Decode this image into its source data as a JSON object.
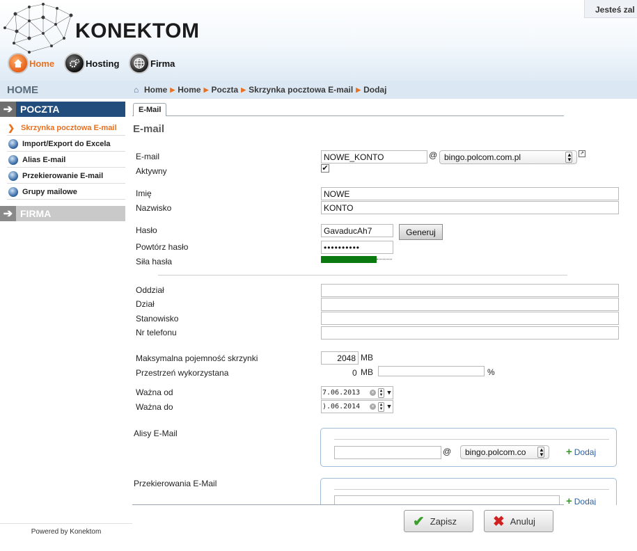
{
  "header": {
    "logo_text": "KONEKTOM",
    "user_status": "Jesteś zal"
  },
  "topnav": [
    {
      "label": "Home"
    },
    {
      "label": "Hosting"
    },
    {
      "label": "Firma"
    }
  ],
  "sidebar": {
    "home_label": "HOME",
    "section_poczta": "POCZTA",
    "items": [
      {
        "label": "Skrzynka pocztowa E-mail"
      },
      {
        "label": "Import/Export do Excela"
      },
      {
        "label": "Alias E-mail"
      },
      {
        "label": "Przekierowanie E-mail"
      },
      {
        "label": "Grupy mailowe"
      }
    ],
    "section_firma": "FIRMA",
    "powered": "Powered by Konektom"
  },
  "breadcrumb": [
    "Home",
    "Home",
    "Poczta",
    "Skrzynka pocztowa E-mail",
    "Dodaj"
  ],
  "tab": {
    "label": "E-Mail"
  },
  "form": {
    "title": "E-mail",
    "email_label": "E-mail",
    "email_value": "NOWE_KONTO",
    "at_sign": "@",
    "domain_value": "bingo.polcom.com.pl",
    "active_label": "Aktywny",
    "active_checked": true,
    "first_name_label": "Imię",
    "first_name_value": "NOWE",
    "last_name_label": "Nazwisko",
    "last_name_value": "KONTO",
    "password_label": "Hasło",
    "password_value": "GavaducAh7",
    "generate_button": "Generuj",
    "repeat_password_label": "Powtórz hasło",
    "repeat_password_value": "••••••••••",
    "strength_label": "Siła hasła",
    "strength_fraction": 0.78,
    "branch_label": "Oddział",
    "department_label": "Dział",
    "position_label": "Stanowisko",
    "phone_label": "Nr telefonu",
    "max_capacity_label": "Maksymalna pojemność skrzynki",
    "max_capacity_value": "2048",
    "mb_unit": "MB",
    "used_space_label": "Przestrzeń wykorzystana",
    "used_space_value": "0",
    "percent_sign": "%",
    "valid_from_label": "Ważna od",
    "valid_from_value": "7.06.2013",
    "valid_to_label": "Ważna do",
    "valid_to_value": ").06.2014",
    "aliases_label": "Alisy E-Mail",
    "alias_domain_value": "bingo.polcom.co",
    "add_label": "Dodaj",
    "redirects_label": "Przekierowania E-Mail"
  },
  "footer": {
    "save_label": "Zapisz",
    "cancel_label": "Anuluj"
  },
  "colors": {
    "accent_orange": "#e8701f",
    "nav_blue": "#234d7c",
    "strength_green": "#0a7a10"
  }
}
